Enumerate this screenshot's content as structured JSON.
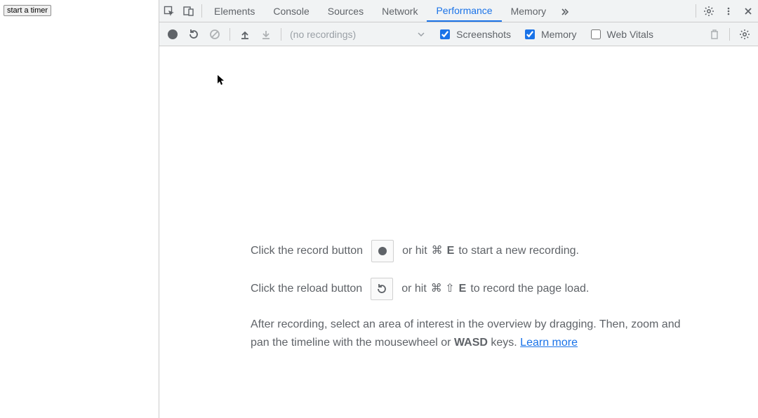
{
  "page": {
    "button_label": "start a timer"
  },
  "tabs": {
    "elements": "Elements",
    "console": "Console",
    "sources": "Sources",
    "network": "Network",
    "performance": "Performance",
    "memory": "Memory"
  },
  "toolbar": {
    "recordings_label": "(no recordings)",
    "screenshots": "Screenshots",
    "memory": "Memory",
    "web_vitals": "Web Vitals",
    "screenshots_checked": true,
    "memory_checked": true,
    "web_vitals_checked": false
  },
  "hint": {
    "line1_a": "Click the record button",
    "line1_b": "or hit",
    "line1_shortcut": "⌘",
    "line1_key": "E",
    "line1_c": "to start a new recording.",
    "line2_a": "Click the reload button",
    "line2_b": "or hit",
    "line2_shortcut": "⌘ ⇧",
    "line2_key": "E",
    "line2_c": "to record the page load.",
    "line3_a": "After recording, select an area of interest in the overview by dragging. Then, zoom and pan the timeline with the mousewheel or ",
    "line3_b": "WASD",
    "line3_c": " keys. ",
    "learn_more": "Learn more"
  }
}
